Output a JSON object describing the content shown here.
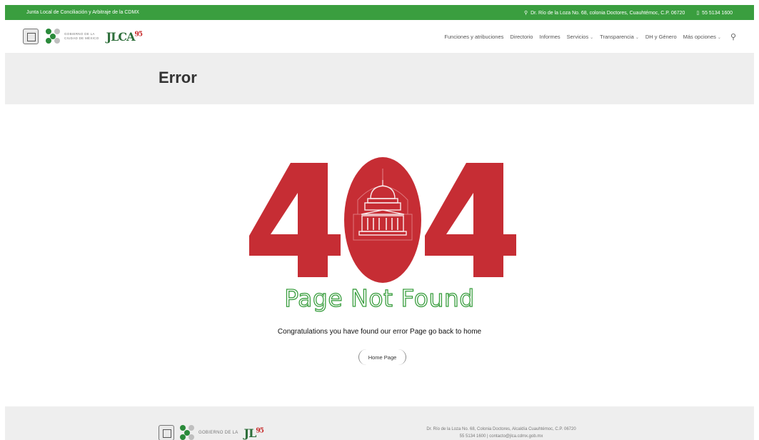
{
  "topbar": {
    "org_name": "Junta Local de Conciliación y Arbitraje de la CDMX",
    "address": "Dr. Río de la Loza No. 68, colonia Doctores, Cuauhtémoc, C.P. 06720",
    "phone": "55 5134 1600",
    "address_icon": "map-pin-icon",
    "phone_icon": "phone-icon"
  },
  "header": {
    "gob_logo_text_line1": "GOBIERNO DE LA",
    "gob_logo_text_line2": "CIUDAD DE MÉXICO",
    "jlca_logo_text": "JLCA",
    "jlca_logo_sup": "95",
    "nav": [
      {
        "label": "Funciones y atribuciones",
        "dropdown": false
      },
      {
        "label": "Directorio",
        "dropdown": false
      },
      {
        "label": "Informes",
        "dropdown": false
      },
      {
        "label": "Servicios",
        "dropdown": true
      },
      {
        "label": "Transparencia",
        "dropdown": true
      },
      {
        "label": "DH y Género",
        "dropdown": false
      },
      {
        "label": "Más opciones",
        "dropdown": true
      }
    ]
  },
  "page": {
    "title": "Error",
    "error_code": "404",
    "not_found": "Page Not Found",
    "message": "Congratulations you have found our error Page go back to home",
    "home_button": "Home Page"
  },
  "footer": {
    "gob_logo_text": "GOBIERNO DE LA",
    "jlca_logo_sup": "95",
    "address_line": "Dr. Río de la Loza No. 68, Colonia Doctores, Alcaldía Cuauhtémoc, C.P. 06720",
    "contact_line": "55 5134 1600 | contacto@jlca.cdmx.gob.mx"
  },
  "colors": {
    "brand_green": "#3a9e3f",
    "error_red": "#c62d34",
    "band_gray": "#eeeeee"
  }
}
